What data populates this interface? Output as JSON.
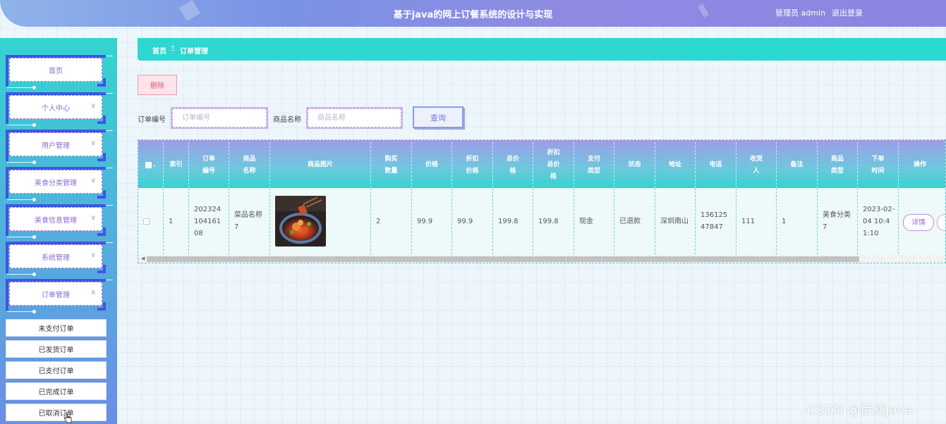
{
  "header": {
    "title": "基于java的网上订餐系统的设计与实现",
    "user_label": "管理员 admin",
    "logout_label": "退出登录"
  },
  "sidebar": {
    "items": [
      {
        "label": "首页",
        "expandable": false
      },
      {
        "label": "个人中心",
        "expandable": true
      },
      {
        "label": "用户管理",
        "expandable": true
      },
      {
        "label": "美食分类管理",
        "expandable": true
      },
      {
        "label": "美食信息管理",
        "expandable": true
      },
      {
        "label": "系统管理",
        "expandable": true
      },
      {
        "label": "订单管理",
        "expandable": true,
        "expanded": true
      }
    ],
    "sub_items": [
      "未支付订单",
      "已发货订单",
      "已支付订单",
      "已完成订单",
      "已取消订单"
    ]
  },
  "breadcrumb": {
    "home": "首页",
    "separator": "Ξ",
    "current": "订单管理"
  },
  "toolbar": {
    "delete_label": "删除",
    "order_no_label": "订单编号",
    "order_no_placeholder": "订单编号",
    "product_name_label": "商品名称",
    "product_name_placeholder": "商品名称",
    "search_label": "查询"
  },
  "table": {
    "headers": [
      "索引",
      "订单编号",
      "商品名称",
      "商品图片",
      "购买数量",
      "价格",
      "折扣价格",
      "总价格",
      "折扣总价格",
      "支付类型",
      "状态",
      "地址",
      "电话",
      "收货人",
      "备注",
      "商品类型",
      "下单时间",
      "操作"
    ],
    "rows": [
      {
        "index": "1",
        "order_no": "20232410416108",
        "product_name": "菜品名称7",
        "quantity": "2",
        "price": "99.9",
        "discount_price": "99.9",
        "total": "199.8",
        "discount_total": "199.8",
        "pay_type": "现金",
        "status": "已退款",
        "address": "深圳南山",
        "phone": "13612547847",
        "receiver": "111",
        "note": "1",
        "product_type": "美食分类7",
        "order_time": "2023-02-04 10:41:10",
        "detail_label": "详情"
      }
    ]
  },
  "watermark": "CSDN @百成Java",
  "colors": {
    "accent_cyan": "#2ed7d0",
    "accent_purple": "#8f8ae2",
    "delete_red": "#d55a7a"
  }
}
